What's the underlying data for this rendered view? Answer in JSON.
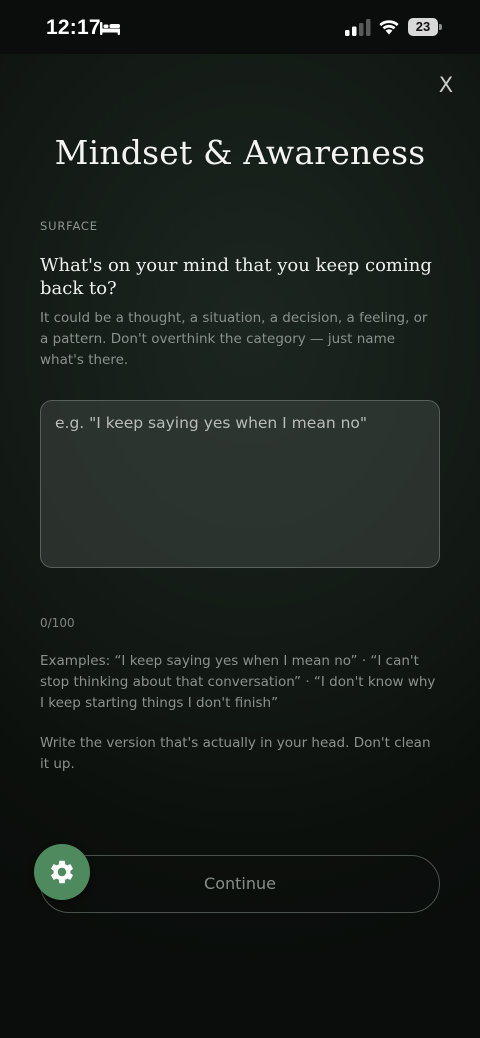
{
  "status_bar": {
    "time": "12:17",
    "battery": "23"
  },
  "header": {
    "close_label": "X",
    "title": "Mindset & Awareness"
  },
  "section": {
    "label": "SURFACE",
    "question": "What's on your mind that you keep coming back to?",
    "description": "It could be a thought, a situation, a decision, a feeling, or a pattern. Don't overthink the category — just name what's there."
  },
  "input": {
    "value": "",
    "placeholder": "e.g. \"I keep saying yes when I mean no\"",
    "counter": "0/100"
  },
  "examples_text": "Examples: “I keep saying yes when I mean no” · “I can't stop thinking about that conversation” · “I don't know why I keep starting things I don't finish”",
  "instruction_text": "Write the version that's actually in your head. Don't clean it up.",
  "footer": {
    "continue_label": "Continue"
  },
  "colors": {
    "fab": "#4e8a5e",
    "background": "#141b16"
  },
  "icons": {
    "bed": "bed-icon",
    "signal": "cellular-signal-icon",
    "wifi": "wifi-icon",
    "battery": "battery-icon",
    "settings": "gear-icon"
  }
}
